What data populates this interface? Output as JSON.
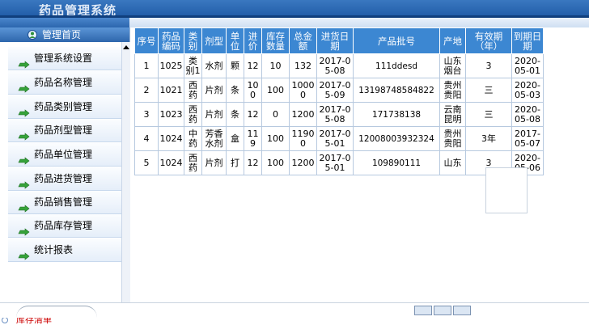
{
  "app": {
    "title": "药品管理系统"
  },
  "sidebar": {
    "home_label": "管理首页",
    "items": [
      {
        "label": "管理系统设置"
      },
      {
        "label": "药品名称管理"
      },
      {
        "label": "药品类别管理"
      },
      {
        "label": "药品剂型管理"
      },
      {
        "label": "药品单位管理"
      },
      {
        "label": "药品进货管理"
      },
      {
        "label": "药品销售管理"
      },
      {
        "label": "药品库存管理"
      },
      {
        "label": "统计报表"
      }
    ],
    "extra_item": "库存清单"
  },
  "table": {
    "columns": [
      "序号",
      "药品编码",
      "类别",
      "剂型",
      "单位",
      "进价",
      "库存数量",
      "总金额",
      "进货日期",
      "产品批号",
      "产地",
      "有效期（年）",
      "到期日期"
    ],
    "rows": [
      [
        "1",
        "1025",
        "类别1",
        "水剂",
        "颗",
        "12",
        "10",
        "132",
        "2017-05-08",
        "111ddesd",
        "山东烟台",
        "3",
        "2020-05-01"
      ],
      [
        "2",
        "1021",
        "西药",
        "片剂",
        "条",
        "100",
        "100",
        "10000",
        "2017-05-09",
        "13198748584822",
        "贵州贵阳",
        "三",
        "2020-05-03"
      ],
      [
        "3",
        "1023",
        "西药",
        "片剂",
        "条",
        "12",
        "0",
        "1200",
        "2017-05-08",
        "171738138",
        "云南昆明",
        "三",
        "2020-05-08"
      ],
      [
        "4",
        "1024",
        "中药",
        "芳香水剂",
        "盒",
        "119",
        "100",
        "11900",
        "2017-05-01",
        "12008003932324",
        "贵州贵阳",
        "3年",
        "2017-05-07"
      ],
      [
        "5",
        "1024",
        "西药",
        "片剂",
        "打",
        "12",
        "100",
        "1200",
        "2017-05-01",
        "109890111",
        "山东",
        "3",
        "2020-05-06"
      ]
    ]
  },
  "colors": {
    "header_bg": "#3c87d2",
    "banner": "#2a63ad",
    "menu_accent": "#2e9a2e"
  },
  "icons": {
    "home": "user-globe-icon",
    "menu": "green-arrow-icon",
    "extra": "circle-bullet-icon"
  }
}
